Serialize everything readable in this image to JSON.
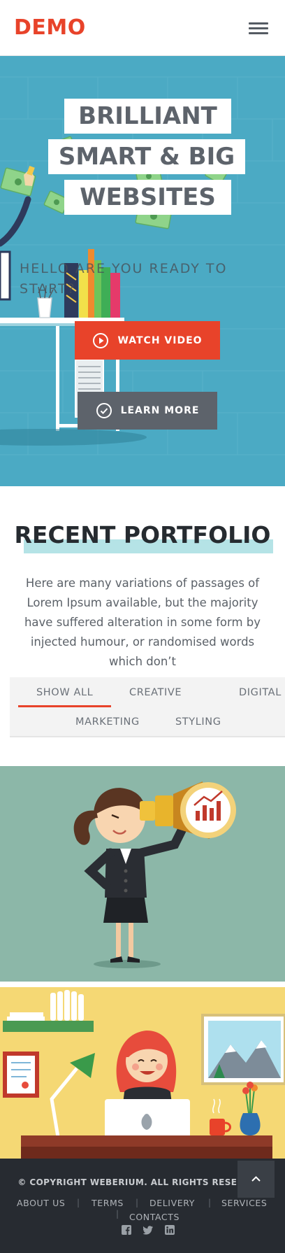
{
  "header": {
    "logo_text": "DEMO",
    "menu_icon": "hamburger-menu-icon"
  },
  "hero": {
    "headline_lines": [
      "BRILLIANT",
      "SMART & BIG",
      "WEBSITES"
    ],
    "subtitle": "HELLO ARE YOU READY TO START?",
    "buttons": [
      {
        "label": "WATCH VIDEO",
        "icon": "play-circle-icon",
        "color": "#e8432a"
      },
      {
        "label": "LEARN MORE",
        "icon": "check-circle-icon",
        "color": "#5d636b"
      }
    ],
    "background_color": "#4baac4"
  },
  "portfolio": {
    "title": "RECENT PORTFOLIO",
    "description": "Here are many variations of passages of Lorem Ipsum available, but the majority have suffered alteration in some form by injected humour, or randomised words which don’t",
    "filters": [
      "SHOW ALL",
      "CREATIVE",
      "DIGITAL",
      "MARKETING",
      "STYLING"
    ],
    "active_filter": "SHOW ALL",
    "items": [
      {
        "illustration": "businesswoman-telescope-illustration"
      },
      {
        "illustration": "woman-at-desk-illustration"
      }
    ]
  },
  "footer": {
    "copyright": "© COPYRIGHT WEBERIUM. ALL RIGHTS RESERVED.",
    "links": [
      "ABOUT US",
      "TERMS",
      "DELIVERY",
      "SERVICES",
      "CONTACTS"
    ],
    "social_icons": [
      "facebook-icon",
      "twitter-icon",
      "linkedin-icon"
    ],
    "scroll_top_icon": "chevron-up-icon"
  },
  "colors": {
    "accent": "#e8432a",
    "dark_text": "#262b30",
    "highlight": "#b5e3e6",
    "footer_bg": "#272b31"
  }
}
